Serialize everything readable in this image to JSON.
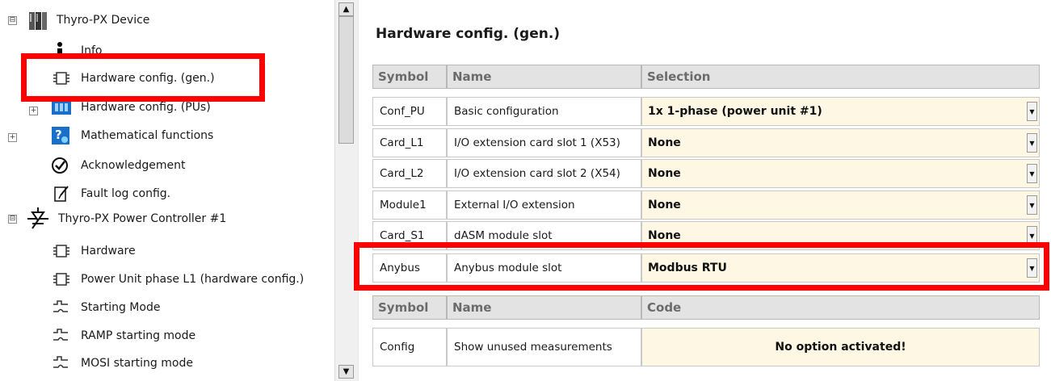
{
  "tree": {
    "items": [
      {
        "label": "Thyro-PX Device",
        "icon": "device-cabinet-icon",
        "expander": "⊟"
      },
      {
        "label": "Info",
        "icon": "info-icon"
      },
      {
        "label": "Hardware config. (gen.)",
        "icon": "chip-icon"
      },
      {
        "label": "Hardware config. (PUs)",
        "icon": "power-units-icon",
        "expander": "+"
      },
      {
        "label": "Mathematical functions",
        "icon": "math-functions-icon",
        "expander": "+"
      },
      {
        "label": "Acknowledgement",
        "icon": "checkmark-circle-icon"
      },
      {
        "label": "Fault log config.",
        "icon": "fault-log-icon"
      },
      {
        "label": "Thyro-PX Power Controller #1",
        "icon": "thyristor-icon",
        "expander": "⊟"
      },
      {
        "label": "Hardware",
        "icon": "chip-icon"
      },
      {
        "label": "Power Unit phase L1 (hardware config.)",
        "icon": "chip-icon"
      },
      {
        "label": "Starting Mode",
        "icon": "waveform-icon"
      },
      {
        "label": "RAMP starting mode",
        "icon": "waveform-icon"
      },
      {
        "label": "MOSI starting mode",
        "icon": "waveform-icon"
      }
    ]
  },
  "scrollbar": {
    "up": "▲",
    "down": "▼"
  },
  "panel": {
    "title": "Hardware config. (gen.)",
    "table1": {
      "headers": [
        "Symbol",
        "Name",
        "Selection"
      ],
      "rows": [
        {
          "symbol": "Conf_PU",
          "name": "Basic configuration",
          "selection": "1x 1-phase (power unit #1)"
        },
        {
          "symbol": "Card_L1",
          "name": "I/O extension card slot 1 (X53)",
          "selection": "None"
        },
        {
          "symbol": "Card_L2",
          "name": "I/O extension card slot 2 (X54)",
          "selection": "None"
        },
        {
          "symbol": "Module1",
          "name": "External I/O extension",
          "selection": "None"
        },
        {
          "symbol": "Card_S1",
          "name": "dASM module slot",
          "selection": "None"
        },
        {
          "symbol": "Anybus",
          "name": "Anybus module slot",
          "selection": "Modbus RTU"
        }
      ]
    },
    "table2": {
      "headers": [
        "Symbol",
        "Name",
        "Code"
      ],
      "rows": [
        {
          "symbol": "Config",
          "name": "Show unused measurements",
          "code": "No option activated!"
        }
      ]
    },
    "dropdown_glyph": "▼"
  },
  "colors": {
    "highlight": "#ff0000",
    "selection_bg": "#fdf7e3",
    "header_bg": "#e3e3e3"
  }
}
